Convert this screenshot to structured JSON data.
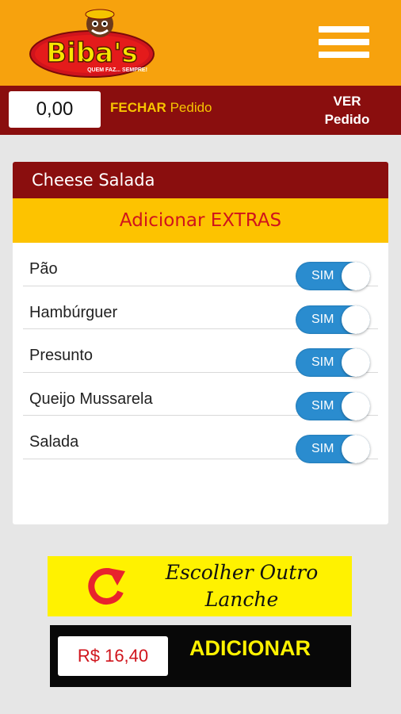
{
  "brand": {
    "logo_text": "Biba's",
    "logo_tagline": "QUEM FAZ... SEMPRE!"
  },
  "order_bar": {
    "total": "0,00",
    "close_strong": "FECHAR",
    "close_soft": "Pedido",
    "view_line1": "VER",
    "view_line2": "Pedido"
  },
  "product": {
    "name": "Cheese Salada",
    "extras_heading": "Adicionar EXTRAS"
  },
  "extras": [
    {
      "label": "Pão",
      "toggle": "SIM"
    },
    {
      "label": "Hambúrguer",
      "toggle": "SIM"
    },
    {
      "label": "Presunto",
      "toggle": "SIM"
    },
    {
      "label": "Queijo Mussarela",
      "toggle": "SIM"
    },
    {
      "label": "Salada",
      "toggle": "SIM"
    }
  ],
  "actions": {
    "another_line1": "Escolher Outro",
    "another_line2": "Lanche",
    "price": "R$ 16,40",
    "add_label": "ADICIONAR"
  },
  "colors": {
    "header": "#f7a20d",
    "dark_red": "#8a0e0e",
    "yellow": "#fdc300",
    "toggle_blue": "#2a8ccf",
    "bright_yellow": "#fff200",
    "red": "#d0141c"
  },
  "icons": {
    "menu": "hamburger-menu-icon",
    "refresh": "refresh-arrow-icon"
  }
}
